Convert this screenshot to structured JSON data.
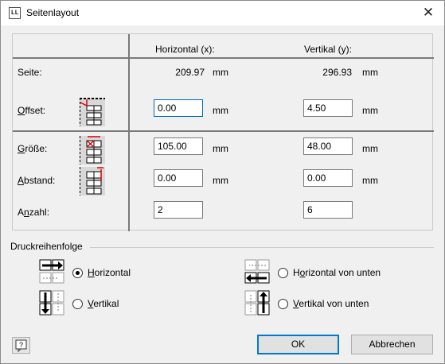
{
  "window": {
    "title": "Seitenlayout",
    "app_icon_text": "LL",
    "close_glyph": "✕"
  },
  "table": {
    "col_h": "Horizontal (x):",
    "col_v": "Vertikal (y):",
    "seite_label": "Seite:",
    "seite_x": "209.97",
    "seite_y": "296.93",
    "unit": "mm",
    "offset_label": "Offset:",
    "offset_x": "0.00",
    "offset_y": "4.50",
    "groesse_label": "Größe:",
    "groesse_x": "105.00",
    "groesse_y": "48.00",
    "abstand_label": "Abstand:",
    "abstand_x": "0.00",
    "abstand_y": "0.00",
    "anzahl_label": "Anzahl:",
    "anzahl_x": "2",
    "anzahl_y": "6"
  },
  "druck": {
    "group_label": "Druckreihenfolge",
    "opt_horizontal": "Horizontal",
    "opt_vertikal": "Vertikal",
    "opt_horizontal_unten": "Horizontal von unten",
    "opt_vertikal_unten": "Vertikal von unten",
    "selected": "Horizontal"
  },
  "buttons": {
    "ok": "OK",
    "cancel": "Abbrechen",
    "help_glyph": "?"
  },
  "colors": {
    "accent": "#0078d7",
    "marker_red": "#e00000"
  }
}
